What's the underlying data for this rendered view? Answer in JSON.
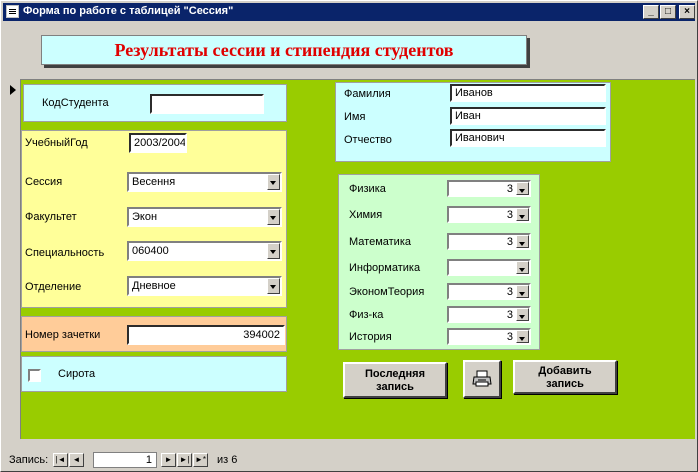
{
  "window": {
    "title": "Форма по работе с таблицей \"Сессия\"",
    "controls": {
      "minimize": "_",
      "maximize": "□",
      "close": "×"
    }
  },
  "banner": {
    "text": "Результаты сессии и стипендия студентов"
  },
  "student_id": {
    "label": "КодСтудента",
    "value": ""
  },
  "academic": {
    "year_label": "УчебныйГод",
    "year_value": "2003/2004",
    "session_label": "Сессия",
    "session_value": "Весення",
    "faculty_label": "Факультет",
    "faculty_value": "Экон",
    "specialty_label": "Специальность",
    "specialty_value": "060400",
    "department_label": "Отделение",
    "department_value": "Дневное"
  },
  "record_book": {
    "label": "Номер зачетки",
    "value": "394002"
  },
  "orphan": {
    "label": "Сирота",
    "checked": false
  },
  "person": {
    "surname_label": "Фамилия",
    "surname_value": "Иванов",
    "name_label": "Имя",
    "name_value": "Иван",
    "patronymic_label": "Отчество",
    "patronymic_value": "Иванович"
  },
  "grades": [
    {
      "subject": "Физика",
      "value": "3"
    },
    {
      "subject": "Химия",
      "value": "3"
    },
    {
      "subject": "Математика",
      "value": "3"
    },
    {
      "subject": "Информатика",
      "value": ""
    },
    {
      "subject": "ЭкономТеория",
      "value": "3"
    },
    {
      "subject": "Физ-ка",
      "value": "3"
    },
    {
      "subject": "История",
      "value": "3"
    }
  ],
  "buttons": {
    "last_record_line1": "Последняя",
    "last_record_line2": "запись",
    "add_record_line1": "Добавить",
    "add_record_line2": "запись",
    "print_icon": "printer-icon"
  },
  "navigation": {
    "record_label": "Запись:",
    "current": "1",
    "total_text": "из 6",
    "first": "|◄",
    "prev": "◄",
    "next": "►",
    "last": "►|",
    "new": "►*"
  },
  "colors": {
    "title_bar": "#0a246a",
    "detail_background": "#99cc00",
    "banner_background": "#ccffff",
    "banner_text": "#e00000",
    "academic_panel": "#ffff99",
    "record_book_panel": "#ffcc99",
    "person_panel": "#ccffff",
    "grades_panel": "#ccffcc"
  }
}
